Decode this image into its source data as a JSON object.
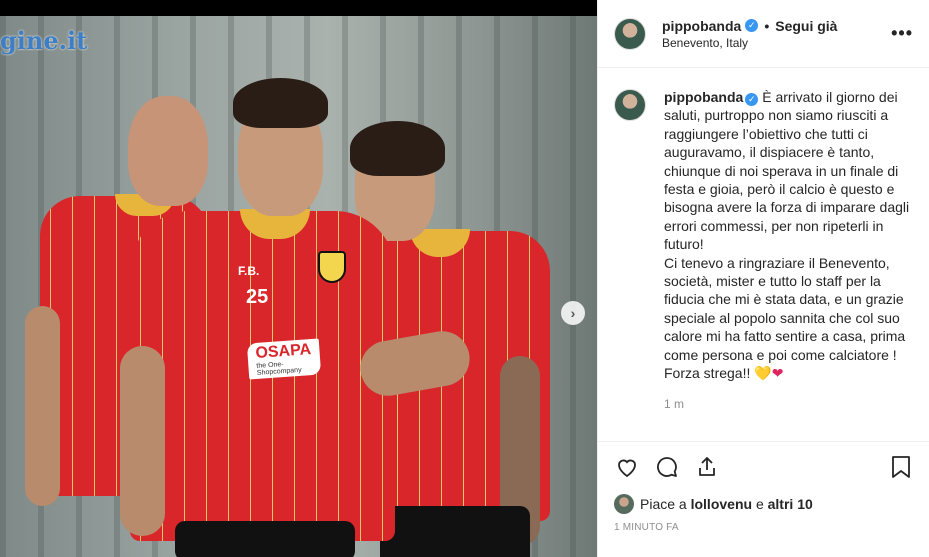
{
  "photo": {
    "watermark": "gine.it",
    "shirt_number": "25",
    "initials": "F.B.",
    "sponsor_name": "OSAPA",
    "sponsor_tagline": "the One-Shopcompany"
  },
  "header": {
    "username": "pippobanda",
    "verified_icon": "verified-badge-icon",
    "separator": "•",
    "follow_label": "Segui già",
    "location": "Benevento, Italy",
    "more_label": "•••"
  },
  "post": {
    "username": "pippobanda",
    "caption_text": "È arrivato il giorno dei saluti, purtroppo non siamo riusciti a raggiungere l’obiettivo che tutti ci auguravamo, il dispiacere è tanto, chiunque di noi sperava in un finale di festa e gioia, però il calcio è questo e bisogna avere la forza di imparare dagli errori commessi, per non ripeterli in futuro!\nCi tenevo a ringraziare il Benevento, società, mister e tutto lo staff per la fiducia che mi è stata data, e un grazie speciale al popolo sannita che col suo calore mi ha fatto sentire a casa, prima come persona e poi come calciatore !\nForza strega!! ",
    "heart_yellow": "💛",
    "heart_red": "❤",
    "time": "1 m"
  },
  "actions": {
    "likes_prefix": "Piace a ",
    "likes_user": "lollovenu",
    "likes_middle": " e ",
    "likes_others": "altri 10",
    "ago": "1 MINUTO FA"
  },
  "colors": {
    "accent": "#3897f0",
    "shirt_red": "#d9262a",
    "shirt_yellow": "#e8b53c",
    "text": "#262626",
    "muted": "#8e8e8e"
  }
}
